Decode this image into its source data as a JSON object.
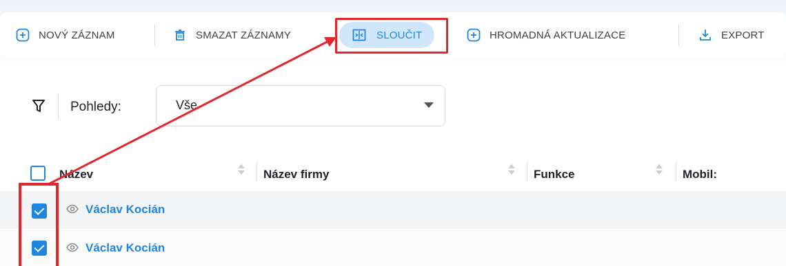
{
  "toolbar": {
    "new_record": "NOVÝ ZÁZNAM",
    "delete_records": "SMAZAT ZÁZNAMY",
    "merge": "SLOUČIT",
    "bulk_update": "HROMADNÁ AKTUALIZACE",
    "export": "EXPORT"
  },
  "filter": {
    "views_label": "Pohledy:",
    "views_value": "Vše"
  },
  "table": {
    "columns": [
      "Název",
      "Název firmy",
      "Funkce",
      "Mobil:"
    ],
    "rows": [
      {
        "name": "Václav Kocián",
        "checked": true
      },
      {
        "name": "Václav Kocián",
        "checked": true
      }
    ]
  },
  "colors": {
    "accent": "#1f86e0",
    "highlight": "#e3262b",
    "merge_bg": "#cfe6fb"
  }
}
